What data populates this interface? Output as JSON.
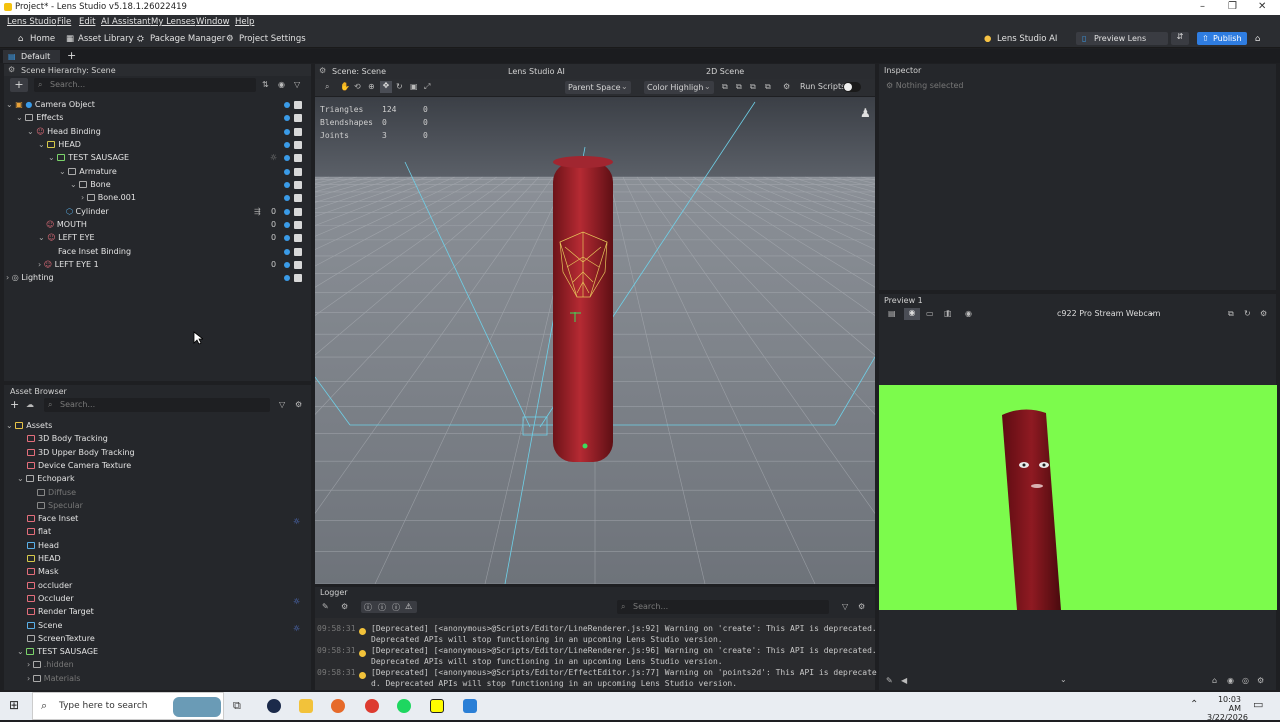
{
  "window": {
    "title": "Project* - Lens Studio v5.18.1.26022419"
  },
  "menu": [
    "Lens Studio",
    "File",
    "Edit",
    "AI Assistant",
    "My Lenses",
    "Window",
    "Help"
  ],
  "toolbar": {
    "home": "Home",
    "asset_library": "Asset Library",
    "package_manager": "Package Manager",
    "project_settings": "Project Settings",
    "lens_ai": "Lens Studio AI",
    "preview_lens": "Preview Lens",
    "publish": "Publish"
  },
  "tabs": {
    "default": "Default"
  },
  "hierarchy": {
    "title": "Scene Hierarchy: Scene",
    "search_placeholder": "Search...",
    "items": [
      {
        "label": "Camera Object",
        "count": ""
      },
      {
        "label": "Effects",
        "count": ""
      },
      {
        "label": "Head Binding",
        "count": ""
      },
      {
        "label": "HEAD",
        "count": ""
      },
      {
        "label": "TEST SAUSAGE",
        "count": ""
      },
      {
        "label": "Armature",
        "count": ""
      },
      {
        "label": "Bone",
        "count": ""
      },
      {
        "label": "Bone.001",
        "count": ""
      },
      {
        "label": "Cylinder",
        "count": "0"
      },
      {
        "label": "MOUTH",
        "count": "0"
      },
      {
        "label": "LEFT EYE",
        "count": "0"
      },
      {
        "label": "Face Inset Binding",
        "count": ""
      },
      {
        "label": "LEFT EYE 1",
        "count": "0"
      },
      {
        "label": "Lighting",
        "count": ""
      }
    ]
  },
  "assets": {
    "title": "Asset Browser",
    "search_placeholder": "Search...",
    "items": [
      "Assets",
      "3D Body Tracking",
      "3D Upper Body Tracking",
      "Device Camera Texture",
      "Echopark",
      "Diffuse",
      "Specular",
      "Face Inset",
      "flat",
      "Head",
      "HEAD",
      "Mask",
      "occluder",
      "Occluder",
      "Render Target",
      "Scene",
      "ScreenTexture",
      "TEST SAUSAGE",
      ".hidden",
      "Materials"
    ]
  },
  "scene": {
    "tab": "Scene: Scene",
    "tab_ai": "Lens Studio AI",
    "tab_2d": "2D Scene",
    "parent_space": "Parent Space",
    "color_highlight": "Color Highligh",
    "run_scripts": "Run Scripts",
    "stats": [
      {
        "label": "Triangles",
        "a": "124",
        "b": "0"
      },
      {
        "label": "Blendshapes",
        "a": "0",
        "b": "0"
      },
      {
        "label": "Joints",
        "a": "3",
        "b": "0"
      }
    ]
  },
  "inspector": {
    "title": "Inspector",
    "empty": "Nothing selected"
  },
  "preview": {
    "title": "Preview 1",
    "camera": "c922 Pro Stream Webcam"
  },
  "logger": {
    "title": "Logger",
    "search_placeholder": "Search...",
    "lines": [
      {
        "time": "09:58:31",
        "text": "[Deprecated] [<anonymous>@Scripts/Editor/LineRenderer.js:92] Warning on 'create': This API is deprecated."
      },
      {
        "time": "",
        "text": "Deprecated APIs will stop functioning in an upcoming Lens Studio version."
      },
      {
        "time": "09:58:31",
        "text": "[Deprecated] [<anonymous>@Scripts/Editor/LineRenderer.js:96] Warning on 'create': This API is deprecated."
      },
      {
        "time": "",
        "text": "Deprecated APIs will stop functioning in an upcoming Lens Studio version."
      },
      {
        "time": "09:58:31",
        "text": "[Deprecated] [<anonymous>@Scripts/Editor/EffectEditor.js:77] Warning on 'points2d': This API is deprecate"
      },
      {
        "time": "",
        "text": "d. Deprecated APIs will stop functioning in an upcoming Lens Studio version."
      }
    ]
  },
  "taskbar": {
    "search": "Type here to search",
    "time": "10:03 AM",
    "date": "3/22/2026"
  }
}
